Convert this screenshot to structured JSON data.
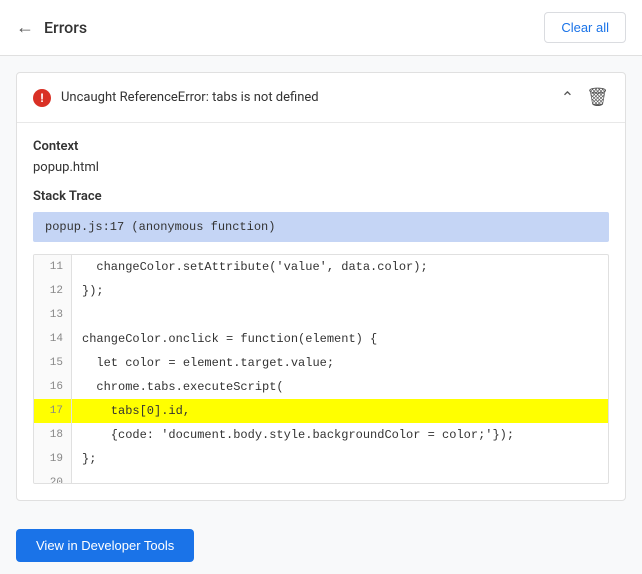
{
  "header": {
    "back_label": "←",
    "title": "Errors",
    "clear_all_label": "Clear all"
  },
  "error": {
    "message": "Uncaught ReferenceError: tabs is not defined",
    "context_label": "Context",
    "context_value": "popup.html",
    "stack_trace_label": "Stack Trace",
    "stack_trace_entry": "popup.js:17 (anonymous function)",
    "code_lines": [
      {
        "num": "11",
        "code": "  changeColor.setAttribute('value', data.color);",
        "highlighted": false
      },
      {
        "num": "12",
        "code": "});",
        "highlighted": false
      },
      {
        "num": "13",
        "code": "",
        "highlighted": false
      },
      {
        "num": "14",
        "code": "changeColor.onclick = function(element) {",
        "highlighted": false
      },
      {
        "num": "15",
        "code": "  let color = element.target.value;",
        "highlighted": false
      },
      {
        "num": "16",
        "code": "  chrome.tabs.executeScript(",
        "highlighted": false
      },
      {
        "num": "17",
        "code": "    tabs[0].id,",
        "highlighted": true
      },
      {
        "num": "18",
        "code": "    {code: 'document.body.style.backgroundColor = color;'});",
        "highlighted": false
      },
      {
        "num": "19",
        "code": "};",
        "highlighted": false
      },
      {
        "num": "20",
        "code": "",
        "highlighted": false
      }
    ]
  },
  "footer": {
    "view_tools_label": "View in Developer Tools"
  }
}
